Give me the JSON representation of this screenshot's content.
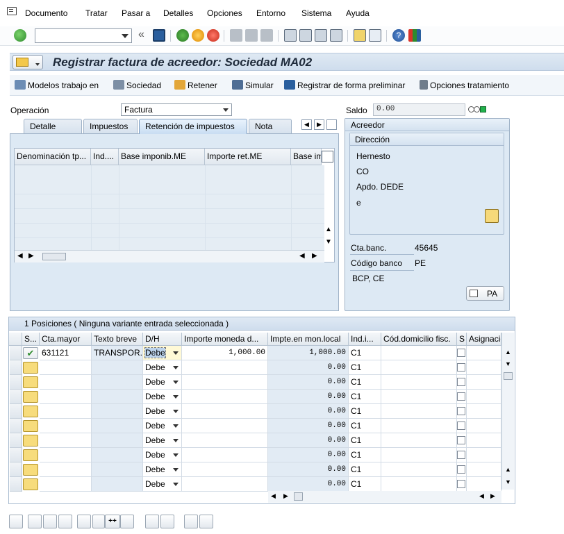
{
  "menu": [
    "Documento",
    "Tratar",
    "Pasar a",
    "Detalles",
    "Opciones",
    "Entorno",
    "Sistema",
    "Ayuda"
  ],
  "menu_underline": [
    "D",
    "T",
    "P",
    "D",
    "O",
    "E",
    "S",
    "A"
  ],
  "toolbar": {
    "command_value": "",
    "icons": [
      "enter-icon",
      "command-field",
      "back-icon",
      "save-icon",
      "back-nav-icon",
      "exit-icon",
      "cancel-icon",
      "print-icon",
      "find-icon",
      "find-next-icon",
      "first-page-icon",
      "prev-page-icon",
      "next-page-icon",
      "last-page-icon",
      "new-session-icon",
      "shortcut-icon",
      "help-icon",
      "customize-layout-icon"
    ]
  },
  "title": "Registrar factura de acreedor: Sociedad MA02",
  "app_toolbar": [
    "Modelos trabajo en",
    "Sociedad",
    "Retener",
    "Simular",
    "Registrar de forma preliminar",
    "Opciones tratamiento"
  ],
  "header": {
    "operacion_label": "Operación",
    "operacion_value": "Factura",
    "saldo_label": "Saldo",
    "saldo_value": "0.00"
  },
  "tabs": [
    "Detalle",
    "Impuestos",
    "Retención de impuestos",
    "Nota"
  ],
  "active_tab": "Retención de impuestos",
  "withholding_columns": [
    "Denominación tp...",
    "Ind....",
    "Base imponib.ME",
    "Importe ret.ME",
    "Base im"
  ],
  "acreedor": {
    "title": "Acreedor",
    "direccion_title": "Dirección",
    "address_lines": [
      "Hernesto",
      "CO",
      "Apdo. DEDE",
      "e"
    ],
    "cta_banc_label": "Cta.banc.",
    "cta_banc_value": "45645",
    "codigo_banco_label": "Código banco",
    "codigo_banco_value": "PE",
    "bank_name": "BCP, CE",
    "pa_button": "PA"
  },
  "positions": {
    "header": "1 Posiciones ( Ninguna variante entrada seleccionada )",
    "columns": [
      "S...",
      "Cta.mayor",
      "Texto breve",
      "D/H",
      "Importe moneda d...",
      "Impte.en mon.local",
      "Ind.i...",
      "Cód.domicilio fisc.",
      "S",
      "Asignación"
    ],
    "rows": [
      {
        "cta": "631121",
        "texto": "TRANSPOR...",
        "dh": "Debe",
        "importe": "1,000.00",
        "local": "1,000.00",
        "ind": "C1"
      },
      {
        "cta": "",
        "texto": "",
        "dh": "Debe",
        "importe": "",
        "local": "0.00",
        "ind": "C1"
      },
      {
        "cta": "",
        "texto": "",
        "dh": "Debe",
        "importe": "",
        "local": "0.00",
        "ind": "C1"
      },
      {
        "cta": "",
        "texto": "",
        "dh": "Debe",
        "importe": "",
        "local": "0.00",
        "ind": "C1"
      },
      {
        "cta": "",
        "texto": "",
        "dh": "Debe",
        "importe": "",
        "local": "0.00",
        "ind": "C1"
      },
      {
        "cta": "",
        "texto": "",
        "dh": "Debe",
        "importe": "",
        "local": "0.00",
        "ind": "C1"
      },
      {
        "cta": "",
        "texto": "",
        "dh": "Debe",
        "importe": "",
        "local": "0.00",
        "ind": "C1"
      },
      {
        "cta": "",
        "texto": "",
        "dh": "Debe",
        "importe": "",
        "local": "0.00",
        "ind": "C1"
      },
      {
        "cta": "",
        "texto": "",
        "dh": "Debe",
        "importe": "",
        "local": "0.00",
        "ind": "C1"
      },
      {
        "cta": "",
        "texto": "",
        "dh": "Debe",
        "importe": "",
        "local": "0.00",
        "ind": "C1"
      }
    ]
  },
  "colors": {
    "accent": "#2e8b2e",
    "title_bg": "#d6e3f0",
    "readonly_cell": "#e2ebf4",
    "status_yellow": "#f7dc7c"
  }
}
